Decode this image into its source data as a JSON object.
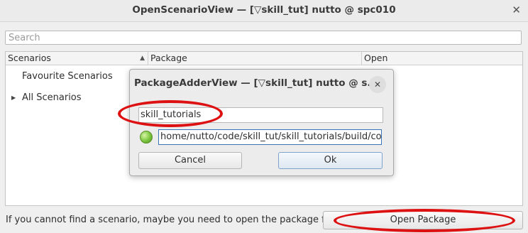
{
  "window": {
    "title": "OpenScenarioView — [▽skill_tut] nutto @ spc010",
    "close_glyph": "✕"
  },
  "search": {
    "placeholder": "Search",
    "value": ""
  },
  "tree": {
    "columns": [
      "Scenarios",
      "Package",
      "Open"
    ],
    "sort_glyph": "▲",
    "items": [
      {
        "label": "Favourite Scenarios",
        "expandable": false
      },
      {
        "label": "All Scenarios",
        "expandable": true,
        "expander_glyph": "▶"
      }
    ]
  },
  "footer": {
    "hint": "If you cannot find a scenario, maybe you need to open the package first:",
    "open_package_label": "Open Package"
  },
  "dialog": {
    "title": "PackageAdderView — [▽skill_tut] nutto @ s...",
    "close_glyph": "✕",
    "package_name": "skill_tutorials",
    "package_path": "home/nutto/code/skill_tut/skill_tutorials/build/config",
    "status_icon": "green-status-led",
    "cancel_label": "Cancel",
    "ok_label": "Ok"
  },
  "annotations": {
    "highlight_color": "#dd1111"
  }
}
